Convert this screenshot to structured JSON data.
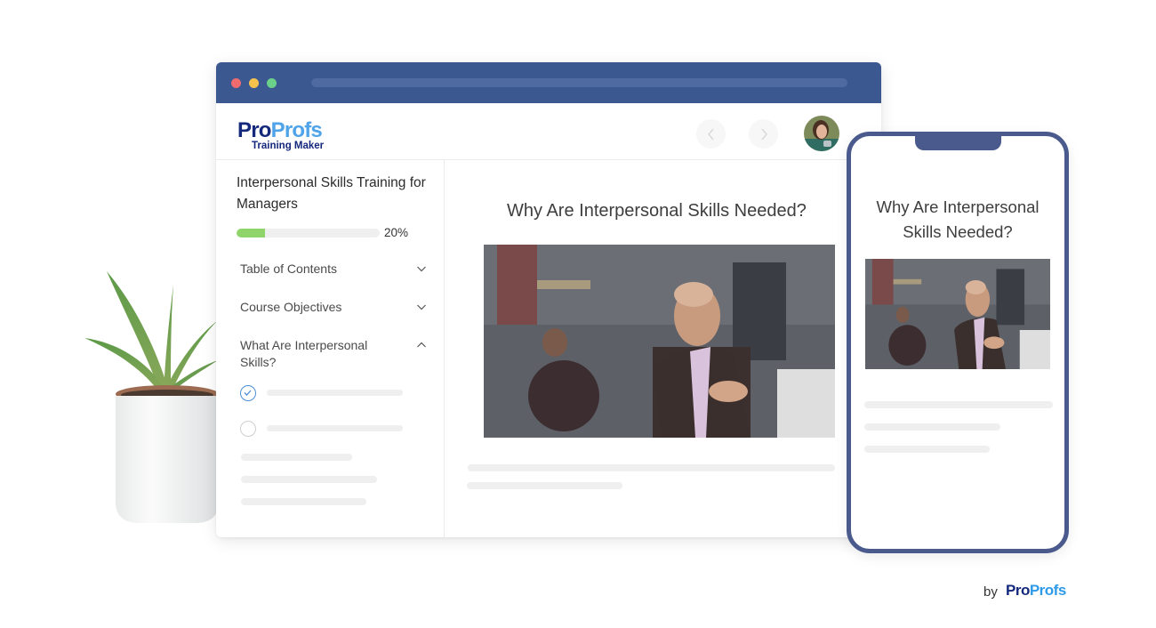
{
  "browser": {
    "window_controls": [
      "close",
      "minimize",
      "maximize"
    ],
    "colors": {
      "titlebar": "#3b5891",
      "urlbar": "#4f6aa0"
    }
  },
  "header": {
    "logo": {
      "part1": "Pro",
      "part2": "Profs",
      "subtitle": "Training Maker"
    },
    "prev_icon": "chevron-left-icon",
    "next_icon": "chevron-right-icon",
    "avatar_icon": "user-avatar"
  },
  "sidebar": {
    "course_title": "Interpersonal Skills Training for Managers",
    "progress": {
      "percent": 20,
      "label": "20%",
      "color": "#8fd56b"
    },
    "toc": [
      {
        "label": "Table of Contents",
        "state": "collapsed",
        "icon": "chevron-down-icon"
      },
      {
        "label": "Course Objectives",
        "state": "collapsed",
        "icon": "chevron-down-icon"
      },
      {
        "label": "What Are Interpersonal Skills?",
        "state": "expanded",
        "icon": "chevron-up-icon"
      }
    ],
    "lessons": [
      {
        "status": "completed",
        "icon": "check-circle-icon"
      },
      {
        "status": "not-started",
        "icon": "empty-circle-icon"
      }
    ]
  },
  "main": {
    "title": "Why Are Interpersonal Skills Needed?",
    "image_alt": "Man in suit speaking in a busy office"
  },
  "phone": {
    "title": "Why Are Interpersonal Skills Needed?",
    "image_alt": "Man in suit speaking in a busy office"
  },
  "footer": {
    "by": "by",
    "brand_part1": "Pro",
    "brand_part2": "Profs"
  }
}
